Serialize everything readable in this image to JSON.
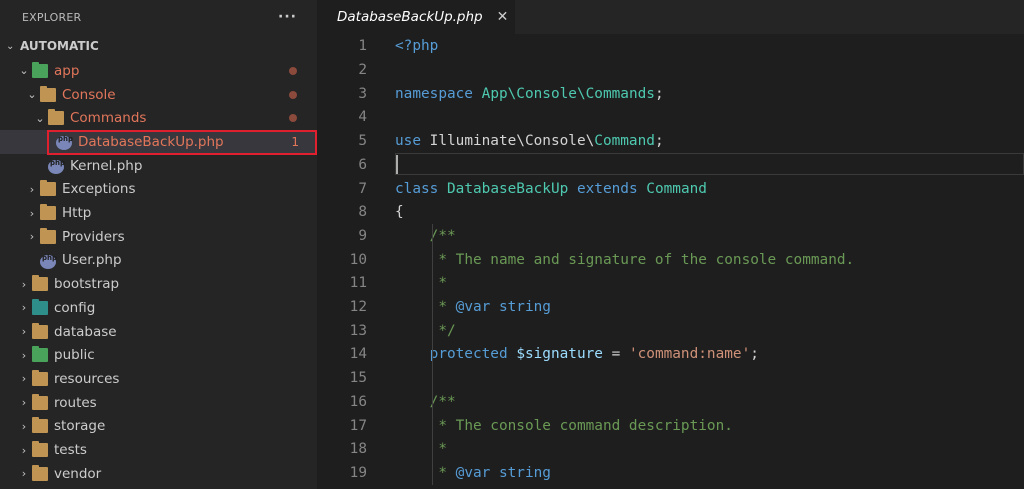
{
  "sidebar": {
    "title": "EXPLORER",
    "more": "···",
    "root": "AUTOMATIC",
    "items": [
      {
        "label": "app",
        "depth": 1,
        "chev": "⌄",
        "icon": "folder-green",
        "modified": true,
        "dot": true
      },
      {
        "label": "Console",
        "depth": 2,
        "chev": "⌄",
        "icon": "folder",
        "modified": true,
        "dot": true
      },
      {
        "label": "Commands",
        "depth": 3,
        "chev": "⌄",
        "icon": "folder",
        "modified": true,
        "dot": true
      },
      {
        "label": "DatabaseBackUp.php",
        "depth": 4,
        "chev": "",
        "icon": "php",
        "modified": true,
        "selected": true,
        "count": "1"
      },
      {
        "label": "Kernel.php",
        "depth": 3,
        "chev": "",
        "icon": "php"
      },
      {
        "label": "Exceptions",
        "depth": 2,
        "chev": "›",
        "icon": "folder"
      },
      {
        "label": "Http",
        "depth": 2,
        "chev": "›",
        "icon": "folder"
      },
      {
        "label": "Providers",
        "depth": 2,
        "chev": "›",
        "icon": "folder"
      },
      {
        "label": "User.php",
        "depth": 2,
        "chev": "",
        "icon": "php"
      },
      {
        "label": "bootstrap",
        "depth": 1,
        "chev": "›",
        "icon": "folder"
      },
      {
        "label": "config",
        "depth": 1,
        "chev": "›",
        "icon": "folder-teal"
      },
      {
        "label": "database",
        "depth": 1,
        "chev": "›",
        "icon": "folder"
      },
      {
        "label": "public",
        "depth": 1,
        "chev": "›",
        "icon": "folder-green"
      },
      {
        "label": "resources",
        "depth": 1,
        "chev": "›",
        "icon": "folder"
      },
      {
        "label": "routes",
        "depth": 1,
        "chev": "›",
        "icon": "folder"
      },
      {
        "label": "storage",
        "depth": 1,
        "chev": "›",
        "icon": "folder"
      },
      {
        "label": "tests",
        "depth": 1,
        "chev": "›",
        "icon": "folder"
      },
      {
        "label": "vendor",
        "depth": 1,
        "chev": "›",
        "icon": "folder"
      }
    ]
  },
  "editor": {
    "tab": {
      "label": "DatabaseBackUp.php",
      "close": "✕"
    },
    "lines": [
      {
        "n": "1",
        "tokens": [
          [
            "tag",
            "<?php"
          ]
        ]
      },
      {
        "n": "2",
        "tokens": []
      },
      {
        "n": "3",
        "tokens": [
          [
            "kw",
            "namespace"
          ],
          [
            "pl",
            " "
          ],
          [
            "ty",
            "App\\Console\\Commands"
          ],
          [
            "pl",
            ";"
          ]
        ]
      },
      {
        "n": "4",
        "tokens": []
      },
      {
        "n": "5",
        "tokens": [
          [
            "kw",
            "use"
          ],
          [
            "pl",
            " Illuminate\\Console\\"
          ],
          [
            "ty",
            "Command"
          ],
          [
            "pl",
            ";"
          ]
        ]
      },
      {
        "n": "6",
        "tokens": []
      },
      {
        "n": "7",
        "tokens": [
          [
            "kw",
            "class"
          ],
          [
            "pl",
            " "
          ],
          [
            "ty",
            "DatabaseBackUp"
          ],
          [
            "pl",
            " "
          ],
          [
            "kw",
            "extends"
          ],
          [
            "pl",
            " "
          ],
          [
            "ty",
            "Command"
          ]
        ]
      },
      {
        "n": "8",
        "tokens": [
          [
            "pl",
            "{"
          ]
        ]
      },
      {
        "n": "9",
        "tokens": [
          [
            "pl",
            "    "
          ],
          [
            "cm",
            "/**"
          ]
        ]
      },
      {
        "n": "10",
        "tokens": [
          [
            "pl",
            "     "
          ],
          [
            "cm",
            "* The name and signature of the console command."
          ]
        ]
      },
      {
        "n": "11",
        "tokens": [
          [
            "pl",
            "     "
          ],
          [
            "cm",
            "*"
          ]
        ]
      },
      {
        "n": "12",
        "tokens": [
          [
            "pl",
            "     "
          ],
          [
            "cm",
            "* "
          ],
          [
            "kw",
            "@var"
          ],
          [
            "pl",
            " "
          ],
          [
            "kw",
            "string"
          ]
        ]
      },
      {
        "n": "13",
        "tokens": [
          [
            "pl",
            "     "
          ],
          [
            "cm",
            "*/"
          ]
        ]
      },
      {
        "n": "14",
        "tokens": [
          [
            "pl",
            "    "
          ],
          [
            "kw",
            "protected"
          ],
          [
            "pl",
            " "
          ],
          [
            "var",
            "$signature"
          ],
          [
            "pl",
            " = "
          ],
          [
            "str",
            "'command:name'"
          ],
          [
            "pl",
            ";"
          ]
        ]
      },
      {
        "n": "15",
        "tokens": []
      },
      {
        "n": "16",
        "tokens": [
          [
            "pl",
            "    "
          ],
          [
            "cm",
            "/**"
          ]
        ]
      },
      {
        "n": "17",
        "tokens": [
          [
            "pl",
            "     "
          ],
          [
            "cm",
            "* The console command description."
          ]
        ]
      },
      {
        "n": "18",
        "tokens": [
          [
            "pl",
            "     "
          ],
          [
            "cm",
            "*"
          ]
        ]
      },
      {
        "n": "19",
        "tokens": [
          [
            "pl",
            "     "
          ],
          [
            "cm",
            "* "
          ],
          [
            "kw",
            "@var"
          ],
          [
            "pl",
            " "
          ],
          [
            "kw",
            "string"
          ]
        ]
      }
    ]
  }
}
